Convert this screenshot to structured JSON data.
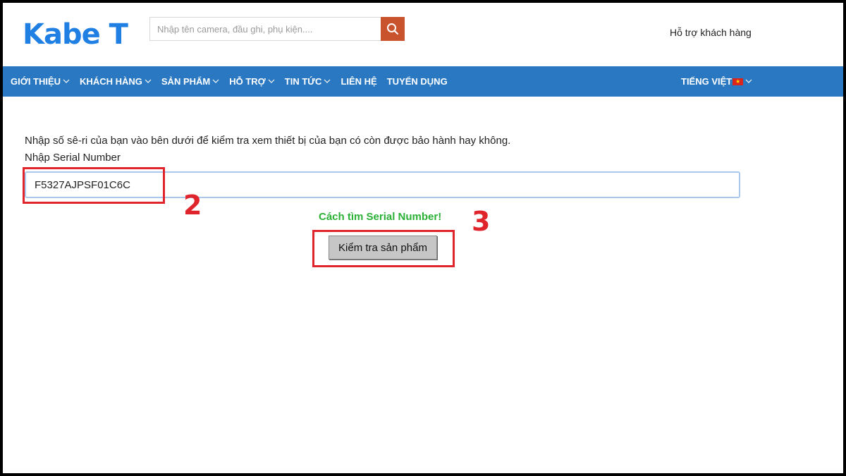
{
  "header": {
    "logo": "Kabe T",
    "search": {
      "placeholder": "Nhập tên camera, đầu ghi, phụ kiện....",
      "icon": "search-icon"
    },
    "support_link": "Hỗ trợ khách hàng"
  },
  "nav": {
    "items": [
      {
        "label": "GIỚI THIỆU",
        "has_dropdown": true
      },
      {
        "label": "KHÁCH HÀNG",
        "has_dropdown": true
      },
      {
        "label": "SẢN PHẨM",
        "has_dropdown": true
      },
      {
        "label": "HỖ TRỢ",
        "has_dropdown": true
      },
      {
        "label": "TIN TỨC",
        "has_dropdown": true
      },
      {
        "label": "LIÊN HỆ",
        "has_dropdown": false
      },
      {
        "label": "TUYỂN DỤNG",
        "has_dropdown": false
      }
    ],
    "language": "TIẾNG VIỆT"
  },
  "main": {
    "intro": "Nhập số sê-ri của bạn vào bên dưới để kiểm tra xem thiết bị của bạn có còn được bảo hành hay không.",
    "serial_label": "Nhập Serial Number",
    "serial_value": "F5327AJPSF01C6C",
    "hint_link": "Cách tìm Serial Number!",
    "check_button": "Kiểm tra sản phẩm"
  },
  "annotations": {
    "step_2": "2",
    "step_3": "3"
  },
  "colors": {
    "brand": "#1f7fe3",
    "nav_bg": "#2a78c2",
    "search_button": "#c9532c",
    "hint": "#2bb036",
    "annotation": "#e0242c"
  }
}
